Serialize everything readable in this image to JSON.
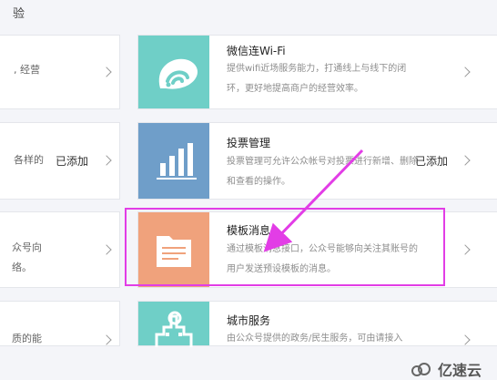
{
  "header_partial": "验",
  "left_column": [
    {
      "text": ", 经营",
      "added": ""
    },
    {
      "text": "各样的",
      "added": "已添加"
    },
    {
      "text": "众号向\n络。",
      "added": ""
    },
    {
      "text": "质的能",
      "added": ""
    }
  ],
  "plugins": [
    {
      "title": "微信连Wi-Fi",
      "desc": "提供wifi近场服务能力，打通线上与线下的闭环，更好地提高商户的经营效率。",
      "added": "",
      "tile_color": "#6fcfc7",
      "icon": "wifi-icon"
    },
    {
      "title": "投票管理",
      "desc": "投票管理可允许公众帐号对投票进行新增、删除和查看的操作。",
      "added": "已添加",
      "tile_color": "#6f9ec9",
      "icon": "bar-chart-icon"
    },
    {
      "title": "模板消息",
      "desc": "通过模板消息接口，公众号能够向关注其账号的用户发送预设模板的消息。",
      "added": "",
      "tile_color": "#f0a27c",
      "icon": "folder-icon"
    },
    {
      "title": "城市服务",
      "desc": "由公众号提供的政务/民生服务，可由请接入",
      "added": "",
      "tile_color": "#6fcfc7",
      "icon": "city-icon"
    }
  ],
  "highlight_color": "#e23de6",
  "watermark": "亿速云"
}
